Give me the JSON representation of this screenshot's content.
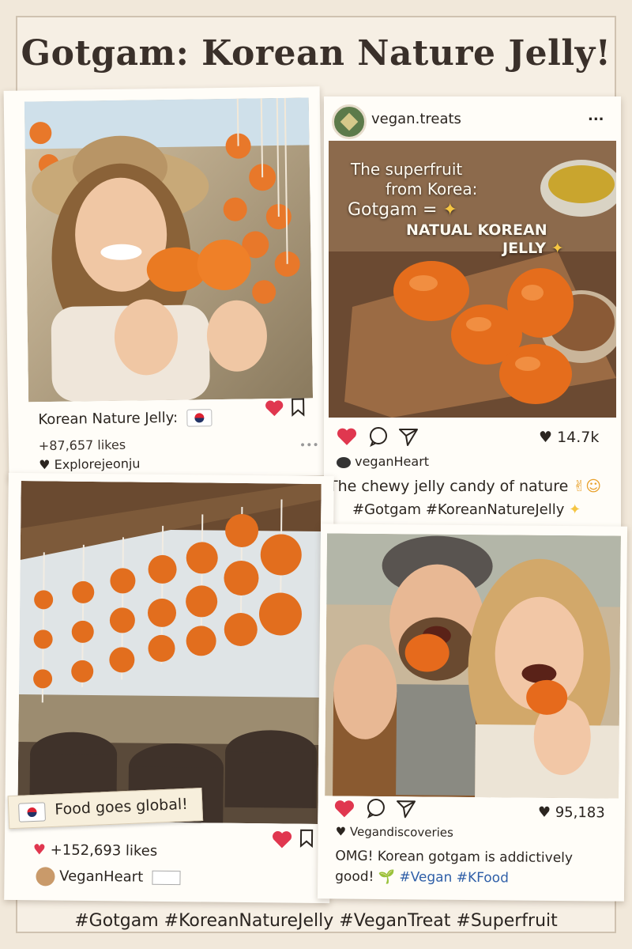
{
  "header": {
    "title": "Gotgam: Korean Nature Jelly!"
  },
  "post1": {
    "caption": "Korean Nature Jelly:",
    "likes": "+87,657 likes",
    "user": "Explorejeonju"
  },
  "post2": {
    "account": "vegan.treats",
    "more": "...",
    "overlay_line1": "The superfruit",
    "overlay_line2": "from Korea:",
    "overlay_line3": "Gotgam =",
    "overlay_line4": "NATUAL KOREAN",
    "overlay_line5": "JELLY",
    "like_count": "14.7k",
    "commenter": "veganHeart",
    "caption": "The chewy jelly candy of nature",
    "hashtags": "#Gotgam #KoreanNatureJelly"
  },
  "post3": {
    "sticker": "Food goes global!",
    "likes": "+152,693 likes",
    "user": "VeganHeart"
  },
  "post4": {
    "like_count": "95,183",
    "user": "Vegandiscoveries",
    "caption_line1": "OMG! Korean gotgam is addictively",
    "caption_line2": "good!",
    "hashtags": "#Vegan #KFood"
  },
  "footer": {
    "hashtags": "#Gotgam #KoreanNatureJelly #VeganTreat #Superfruit"
  },
  "colors": {
    "heart": "#e0374f",
    "persimmon": "#e8782a",
    "paper": "#f6efe4"
  },
  "icons": [
    "heart-icon",
    "bookmark-icon",
    "comment-icon",
    "share-icon",
    "more-icon",
    "korean-flag-icon",
    "sparkle-icon"
  ]
}
